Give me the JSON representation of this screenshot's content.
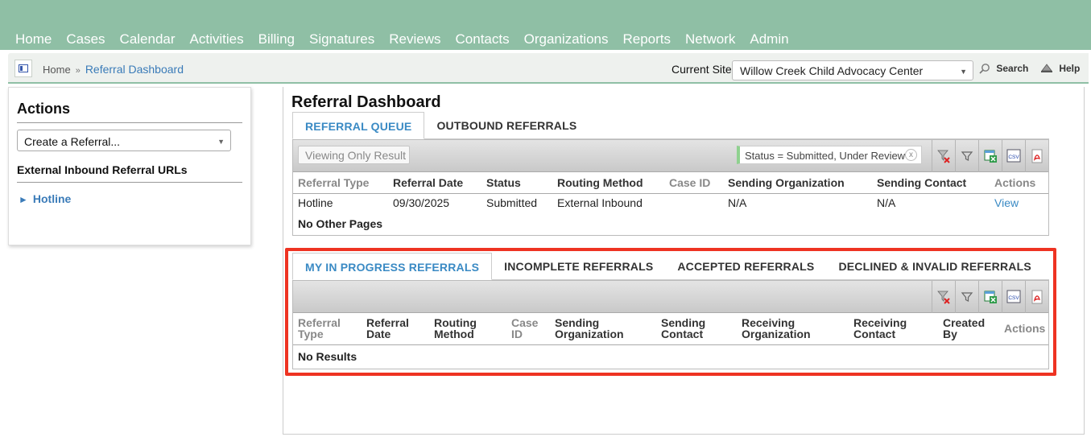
{
  "nav": {
    "items": [
      "Home",
      "Cases",
      "Calendar",
      "Activities",
      "Billing",
      "Signatures",
      "Reviews",
      "Contacts",
      "Organizations",
      "Reports",
      "Network",
      "Admin"
    ]
  },
  "breadcrumb": {
    "home": "Home",
    "separator": "»",
    "current": "Referral Dashboard"
  },
  "site": {
    "label": "Current Site",
    "selected": "Willow Creek Child Advocacy Center"
  },
  "header_links": {
    "search": "Search",
    "help": "Help"
  },
  "actions": {
    "title": "Actions",
    "create_select": "Create a Referral...",
    "external_heading": "External Inbound Referral URLs",
    "links": [
      "Hotline"
    ]
  },
  "main": {
    "title": "Referral Dashboard",
    "top_tabs": [
      "REFERRAL QUEUE",
      "OUTBOUND REFERRALS"
    ],
    "queue": {
      "viewing_button": "Viewing Only Result",
      "filter_chip": "Status = Submitted, Under Review",
      "filter_remove": "x",
      "columns": [
        "Referral Type",
        "Referral Date",
        "Status",
        "Routing Method",
        "Case ID",
        "Sending Organization",
        "Sending Contact",
        "Actions"
      ],
      "rows": [
        [
          "Hotline",
          "09/30/2025",
          "Submitted",
          "External Inbound",
          "",
          "N/A",
          "N/A",
          "View"
        ]
      ],
      "footer": "No Other Pages"
    },
    "bottom_tabs": [
      "MY IN PROGRESS REFERRALS",
      "INCOMPLETE REFERRALS",
      "ACCEPTED REFERRALS",
      "DECLINED & INVALID REFERRALS"
    ],
    "progress": {
      "columns": [
        [
          "Referral",
          "Type"
        ],
        [
          "Referral",
          "Date"
        ],
        [
          "Routing",
          "Method"
        ],
        [
          "Case",
          "ID"
        ],
        [
          "Sending",
          "Organization"
        ],
        [
          "Sending",
          "Contact"
        ],
        [
          "Receiving",
          "Organization"
        ],
        [
          "Receiving",
          "Contact"
        ],
        [
          "Created",
          "By"
        ],
        [
          "Actions",
          ""
        ]
      ],
      "empty": "No Results"
    },
    "tool_icons": [
      "clear-filter-icon",
      "filter-icon",
      "excel-export-icon",
      "csv-export-icon",
      "pdf-export-icon"
    ],
    "csv_label": "CSV"
  },
  "colors": {
    "nav_bg": "#8fbfa5",
    "link": "#3a8ac4",
    "highlight": "#ee3322"
  }
}
